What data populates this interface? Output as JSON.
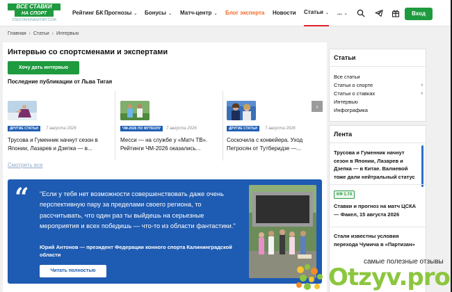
{
  "brand": {
    "logo_line1": "ВСЕ СТАВКИ",
    "logo_line2": "НА СПОРТ",
    "logo_line3": "VSESTAVKINASPORT.COM",
    "accent": "#1e9a3f"
  },
  "nav": {
    "items": [
      {
        "label": "Рейтинг БК",
        "chev": "⌄"
      },
      {
        "label": "Прогнозы",
        "chev": "⌄"
      },
      {
        "label": "Бонусы",
        "chev": "⌄"
      },
      {
        "label": "Матч-центр",
        "chev": "⌄"
      },
      {
        "label": "Блог эксперта",
        "chev": ""
      },
      {
        "label": "Новости",
        "chev": ""
      },
      {
        "label": "Статьи",
        "chev": "⌄"
      },
      {
        "label": "...",
        "chev": "⌄"
      }
    ],
    "login": "Вход"
  },
  "breadcrumb": [
    "Главная",
    "Статьи",
    "Интервью"
  ],
  "main": {
    "title": "Интервью со спортсменами и экспертами",
    "want_button": "Хочу дать интервью",
    "pubs_title": "Последние публикации от Льва Тигая",
    "articles": [
      {
        "tag": "ДРУГИЕ СТАТЬИ",
        "date": "7 августа 2026",
        "text": "Трусова и Гуменник начнут сезон в Японии, Лазарев и Дзепка — в..."
      },
      {
        "tag": "ЧМ-2026 ПО ФУТБОЛУ",
        "date": "7 августа 2026",
        "text": "Месси — на службе у «Матч ТВ». Рейтинги ЧМ-2026 оказались..."
      },
      {
        "tag": "ДРУГИЕ СТАТЬИ",
        "date": "7 августа 2026",
        "text": "Соскочила с конвейера. Уход Петросян от Тутберидзе —..."
      }
    ],
    "next_arrow": "›",
    "see_all": "Смотреть все",
    "quote": {
      "mark": "“",
      "text": "\"Если у тебя нет возможности совершенствовать даже очень перспективную пару за пределами своего региона, то рассчитывать, что один раз ты выйдешь на серьезные мероприятия и всех победишь — что-то из области фантастики.\"",
      "author": "Юрий Антонов — президент Федерации конного спорта Калининградской области",
      "button": "Читать полностью"
    }
  },
  "sidebar": {
    "articles_title": "Статьи",
    "articles": [
      {
        "label": "Все статьи",
        "arrow": ""
      },
      {
        "label": "Статьи о спорте",
        "arrow": "›"
      },
      {
        "label": "Статьи о ставках",
        "arrow": "›"
      },
      {
        "label": "Интервью",
        "arrow": ""
      },
      {
        "label": "Инфографика",
        "arrow": ""
      }
    ],
    "feed_title": "Лента",
    "feed": [
      {
        "title": "Трусова и Гуменник начнут сезон в Японии, Лазарев и Дзепка — в Китае. Валиевой тоже дали нейтральный статус"
      },
      {
        "badge": "КФ 1.74",
        "title": "Ставки и прогноз на матч ЦСКА — Факел, 15 августа 2026"
      },
      {
        "title": "Стали известны условия перехода Чумича в «Партизан»"
      }
    ]
  },
  "watermark": {
    "tagline": "самые полезные отзывы",
    "site": "Otzyv.pro"
  }
}
